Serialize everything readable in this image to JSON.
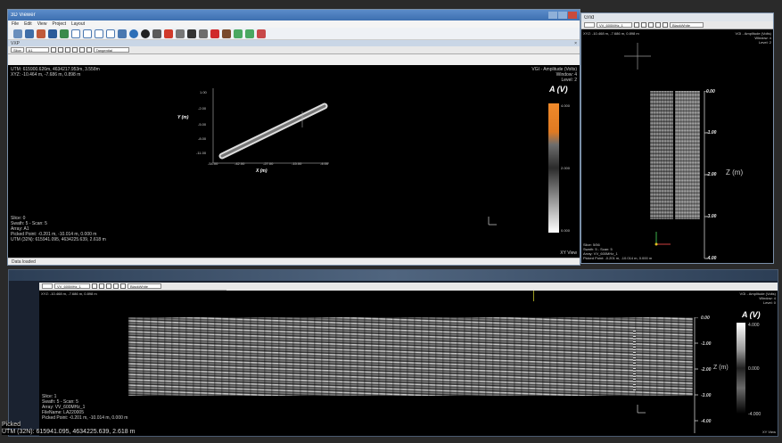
{
  "main_window": {
    "title": "3D Viewer",
    "menus": [
      "File",
      "Edit",
      "View",
      "Project",
      "Layout"
    ],
    "panel_header": "VXP",
    "view_dropdown": "Slice",
    "array_dropdown": "A1",
    "transform_dropdown": "Tangential",
    "top_left": [
      "UTM: 615900.626m, 4634217.953m, 3.558m",
      "XYZ: -10.464 m, -7.686 m, 0.898 m"
    ],
    "top_right": [
      "VGI - Amplitude (Volts)",
      "Window: 4",
      "Level: 2"
    ],
    "bottom_left": [
      "Slice: 0",
      "Swath: 5 - Scan: 5",
      "Array: A1",
      "Picked Point: -0.201 m, -10.014 m, 0.000 m",
      "UTM (32N): 615941.095, 4634225.639, 2.618 m"
    ],
    "xy_view_label": "XY View",
    "plan_axes": {
      "y_label": "Y (m)",
      "x_label": "X (m)",
      "y_ticks": [
        "1.00",
        "-2.00",
        "-5.00",
        "-8.00",
        "-11.00"
      ],
      "x_ticks": [
        "-54.00",
        "-42.00",
        "-27.00",
        "-15.00",
        "-4.00"
      ]
    },
    "colorbar": {
      "label": "A (V)",
      "ticks": [
        "4.000",
        "2.000",
        "0.000"
      ]
    },
    "status": "Data loaded"
  },
  "side_window": {
    "title": "Grid",
    "array_dropdown": "VV_600MHz_1",
    "color_dropdown": "BlackWhite",
    "top_left": "XYZ: -10.468 m, -7.686 m, 0.898 m",
    "top_right": [
      "VGI - Amplitude (Volts)",
      "Window: 4",
      "Level: 2"
    ],
    "bottom_left": [
      "Slice: 5/56",
      "Swath: 5 - Scan: 5",
      "Array: VV_600MHz_1",
      "Picked Point: -0.201 m, -10.014 m, 0.000 m"
    ],
    "depth_ticks": [
      "0.00",
      "-1.00",
      "-2.00",
      "-3.00",
      "-4.00"
    ],
    "depth_label": "Z (m)"
  },
  "section_window": {
    "array_dropdown": "VV_600MHz_1",
    "color_dropdown": "BlackWhite",
    "top_left": "XYZ: -10.468 m, -7.686 m, 0.898 m",
    "top_right": [
      "VGI - Amplitude (Volts)",
      "Window: 4",
      "Level: 0"
    ],
    "bottom_left": [
      "Slice: 1",
      "Swath: 5 - Scan: 5",
      "Array: VV_600MHz_1",
      "FileName: LA220005",
      "Picked Point: -0.201 m, -10.014 m, 0.000 m"
    ],
    "depth_ticks": [
      "0.00",
      "-1.00",
      "-2.00",
      "-3.00",
      "-4.00"
    ],
    "depth_label": "Z (m)",
    "colorbar": {
      "label": "A (V)",
      "ticks": [
        "4.000",
        "0.000",
        "-4.000"
      ]
    },
    "xy_view_label": "XY View"
  },
  "footer": {
    "picked": "Picked",
    "utm": "UTM (32N): 615941.095, 4634225.639, 2.618 m"
  }
}
